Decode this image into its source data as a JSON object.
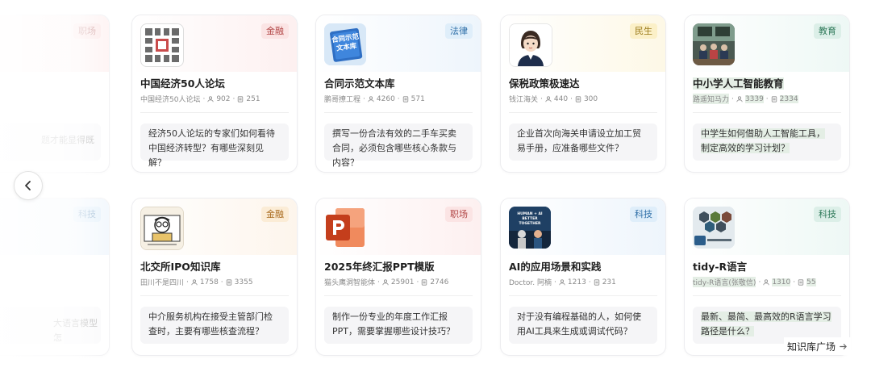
{
  "cards": [
    {
      "title": "中国经济50人论坛",
      "author": "中国经济50人论坛",
      "members": "902",
      "docs": "251",
      "tag": "金融",
      "tag_bg": "#fbe4e4",
      "tag_color": "#b24747",
      "band": "#fdf0f0",
      "question": "经济50人论坛的专家们如何看待中国经济转型？有哪些深刻见解？",
      "thumb_icon": "seal-logo-icon"
    },
    {
      "title": "合同示范文本库",
      "author": "鹏哥撩工程",
      "members": "4260",
      "docs": "571",
      "tag": "法律",
      "tag_bg": "#dfeefa",
      "tag_color": "#2f6fa8",
      "band": "#eef5fc",
      "question": "撰写一份合法有效的二手车买卖合同，必须包含哪些核心条款与内容？",
      "thumb_icon": "contract-book-icon",
      "thumb_text": "合同示范文本库"
    },
    {
      "title": "保税政策极速达",
      "author": "钱江海关",
      "members": "440",
      "docs": "300",
      "tag": "民生",
      "tag_bg": "#fbf0c8",
      "tag_color": "#9a7a18",
      "band": "#fdf8e6",
      "question": "企业首次向海关申请设立加工贸易手册，应准备哪些文件？",
      "thumb_icon": "officer-avatar-icon"
    },
    {
      "title": "中小学人工智能教育",
      "author": "路遥知马力",
      "members": "3339",
      "docs": "2334",
      "tag": "教育",
      "tag_bg": "#dcefe8",
      "tag_color": "#2f7a5a",
      "band": "#eef8f5",
      "question": "中学生如何借助人工智能工具，制定高效的学习计划？",
      "thumb_icon": "classroom-photo-icon"
    },
    {
      "title": "北交所IPO知识库",
      "author": "田川不是四川",
      "members": "1758",
      "docs": "3355",
      "tag": "金融",
      "tag_bg": "#fbecd6",
      "tag_color": "#a86a1e",
      "band": "#fdf5ec",
      "question": "中介服务机构在接受主管部门检查时，主要有哪些核查流程？",
      "thumb_icon": "cartoon-reader-icon"
    },
    {
      "title": "2025年终汇报PPT模版",
      "author": "猫头鹰洞智能体",
      "members": "25901",
      "docs": "2746",
      "tag": "职场",
      "tag_bg": "#fbe4e4",
      "tag_color": "#b24747",
      "band": "#fdf0f0",
      "question": "制作一份专业的年度工作汇报PPT，需要掌握哪些设计技巧？",
      "thumb_icon": "powerpoint-icon"
    },
    {
      "title": "AI的应用场景和实践",
      "author": "Doctor. 阿楠",
      "members": "1213",
      "docs": "231",
      "tag": "科技",
      "tag_bg": "#dfeefa",
      "tag_color": "#2f6fa8",
      "band": "#eef5fc",
      "question": "对于没有编程基础的人，如何使用AI工具来生成或调试代码？",
      "thumb_icon": "ai-poster-icon",
      "thumb_text": "HUMAN + AI BETTER TOGETHER"
    },
    {
      "title": "tidy-R语言",
      "author": "tidy-R语言(张敬信)",
      "members": "1310",
      "docs": "55",
      "tag": "科技",
      "tag_bg": "#dcefe8",
      "tag_color": "#2f7a5a",
      "band": "#eef8f5",
      "question": "最新、最简、最高效的R语言学习路径是什么？",
      "thumb_icon": "r-hexagon-book-icon"
    }
  ],
  "ghost_left": [
    {
      "tag": "职场",
      "tag_bg": "#fbe4e4",
      "tag_color": "#c48585",
      "text": "题才能显得既"
    },
    {
      "tag": "科技",
      "tag_bg": "#dfeefa",
      "tag_color": "#7fa5c8",
      "text": "大语言模型怎"
    }
  ],
  "nav": {
    "more_label": "知识库广场",
    "prev_icon": "chevron-left-icon",
    "arrow_icon": "arrow-right-icon"
  }
}
